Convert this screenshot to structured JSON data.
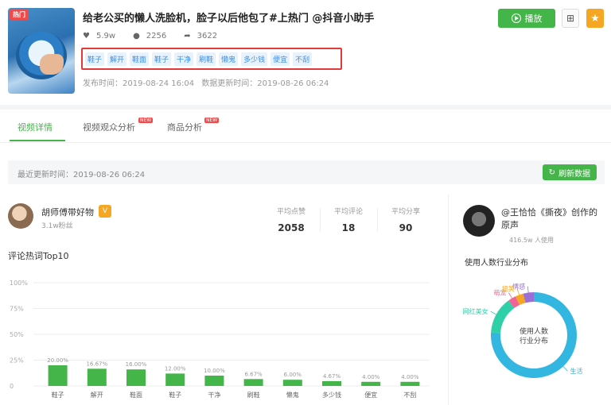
{
  "video": {
    "badge": "热门",
    "title": "给老公买的懒人洗脸机，脸子以后他包了#上热门 @抖音小助手",
    "stats": [
      {
        "icon": "heart-icon",
        "glyph": "♥",
        "value": "5.9w"
      },
      {
        "icon": "comment-icon",
        "glyph": "●",
        "value": "2256"
      },
      {
        "icon": "share-icon",
        "glyph": "➦",
        "value": "3622"
      }
    ],
    "tags": [
      "鞋子",
      "解开",
      "鞋面",
      "鞋子",
      "干净",
      "刷鞋",
      "懒鬼",
      "多少钱",
      "便宜",
      "不刮"
    ],
    "publish_label": "发布时间：2019-08-24 16:04",
    "data_update_label": "数据更新时间：2019-08-26 06:24"
  },
  "actions": {
    "play_label": "播放",
    "qr_glyph": "⊞",
    "star_glyph": "★"
  },
  "tabs": [
    {
      "label": "视频详情",
      "new": false
    },
    {
      "label": "视频观众分析",
      "new": true
    },
    {
      "label": "商品分析",
      "new": true
    }
  ],
  "new_badge": "NEW",
  "update": {
    "label": "最近更新时间：2019-08-26 06:24",
    "refresh_label": "刷新数据",
    "refresh_glyph": "↻"
  },
  "author": {
    "name": "胡师傅带好物",
    "fans": "3.1w粉丝",
    "badge": "V",
    "metrics": [
      {
        "label": "平均点赞",
        "value": "2058"
      },
      {
        "label": "平均评论",
        "value": "18"
      },
      {
        "label": "平均分享",
        "value": "90"
      }
    ]
  },
  "chart_title": "评论热词Top10",
  "chart_data": {
    "type": "bar",
    "title": "评论热词Top10",
    "categories": [
      "鞋子",
      "解开",
      "鞋面",
      "鞋子",
      "干净",
      "刷鞋",
      "懒鬼",
      "多少钱",
      "便宜",
      "不刮"
    ],
    "values": [
      20.0,
      16.67,
      16.0,
      12.0,
      10.0,
      6.67,
      6.0,
      4.67,
      4.0,
      4.0
    ],
    "value_labels": [
      "20.00%",
      "16.67%",
      "16.00%",
      "12.00%",
      "10.00%",
      "6.67%",
      "6.00%",
      "4.67%",
      "4.00%",
      "4.00%"
    ],
    "y_ticks": [
      "100%",
      "75%",
      "50%",
      "25%",
      "0"
    ],
    "ylim": [
      0,
      100
    ],
    "color": "#44b549"
  },
  "music": {
    "name": "@王恰恰《撕夜》创作的原声",
    "fans": "416.5w 人使用",
    "subtitle": "使用人数行业分布",
    "donut_center": "使用人数行业分布",
    "segments": [
      {
        "label": "生活",
        "value": 76,
        "color": "#33b6e0"
      },
      {
        "label": "网红美女",
        "value": 14,
        "color": "#2fcfa8"
      },
      {
        "label": "萌宠",
        "value": 3,
        "color": "#f06595"
      },
      {
        "label": "搞笑",
        "value": 3,
        "color": "#f5a623"
      },
      {
        "label": "情感",
        "value": 4,
        "color": "#9b6fd6"
      }
    ]
  }
}
